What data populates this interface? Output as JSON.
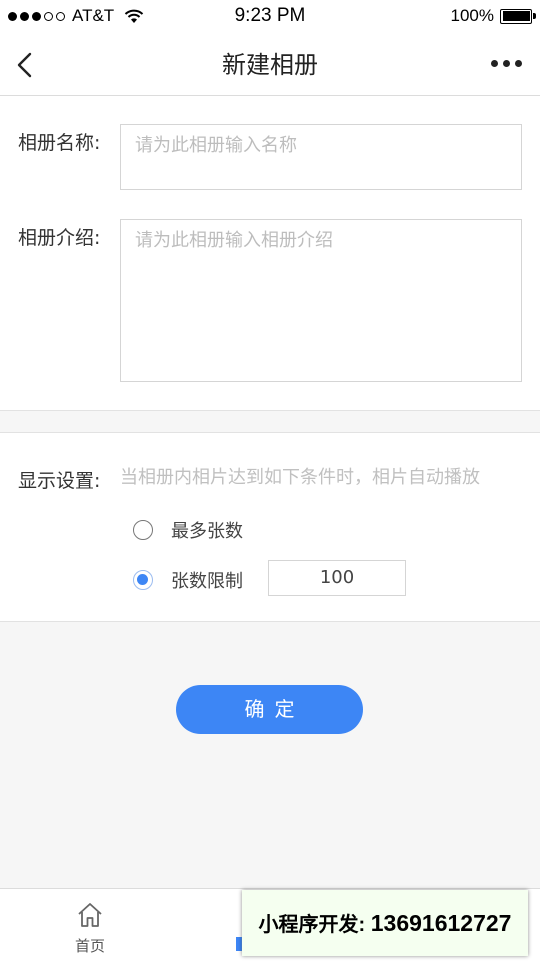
{
  "status_bar": {
    "carrier": "AT&T",
    "time": "9:23 PM",
    "battery": "100%"
  },
  "navbar": {
    "title": "新建相册",
    "back_icon": "chevron-left-icon",
    "more_icon": "more-dots-icon"
  },
  "form": {
    "name_label": "相册名称:",
    "name_placeholder": "请为此相册输入名称",
    "intro_label": "相册介绍:",
    "intro_placeholder": "请为此相册输入相册介绍"
  },
  "display": {
    "label": "显示设置:",
    "hint": "当相册内相片达到如下条件时，相片自动播放",
    "options": [
      {
        "label": "最多张数",
        "selected": false
      },
      {
        "label": "张数限制",
        "selected": true
      }
    ],
    "limit_value": "100"
  },
  "confirm_label": "确定",
  "tabbar": {
    "home_label": "首页",
    "home_icon": "home-icon"
  },
  "overlay": {
    "prefix": "小程序开发:",
    "phone": "13691612727"
  },
  "colors": {
    "accent": "#3d86f5",
    "background": "#f6f6f6"
  }
}
